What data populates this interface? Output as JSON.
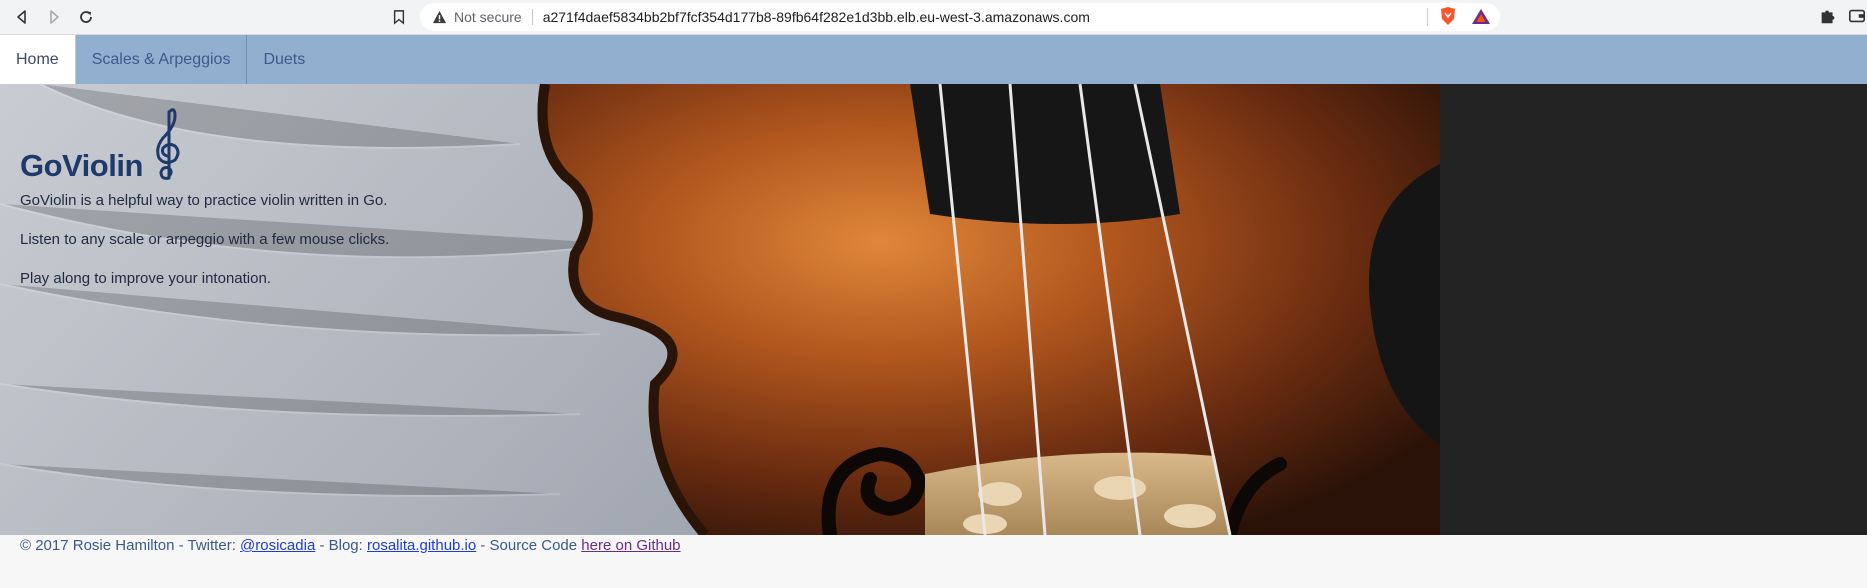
{
  "browser": {
    "security_label": "Not secure",
    "url": "a271f4daef5834bb2bf7fcf354d177b8-89fb64f282e1d3bb.elb.eu-west-3.amazonaws.com"
  },
  "nav": {
    "tabs": [
      {
        "label": "Home",
        "active": true
      },
      {
        "label": "Scales & Arpeggios",
        "active": false
      },
      {
        "label": "Duets",
        "active": false
      }
    ]
  },
  "hero": {
    "title": "GoViolin",
    "lines": [
      "GoViolin is a helpful way to practice violin written in Go.",
      "Listen to any scale or arpeggio with a few mouse clicks.",
      "Play along to improve your intonation."
    ]
  },
  "footer": {
    "prefix": "© 2017 Rosie Hamilton - Twitter: ",
    "twitter_link": "@rosicadia",
    "blog_text": " - Blog: ",
    "blog_link": "rosalita.github.io",
    "source_text": " - Source Code ",
    "github_link": "here on Github"
  },
  "colors": {
    "nav_bg": "#93afd0",
    "title": "#1d3a6a",
    "dark_panel": "#232323"
  }
}
